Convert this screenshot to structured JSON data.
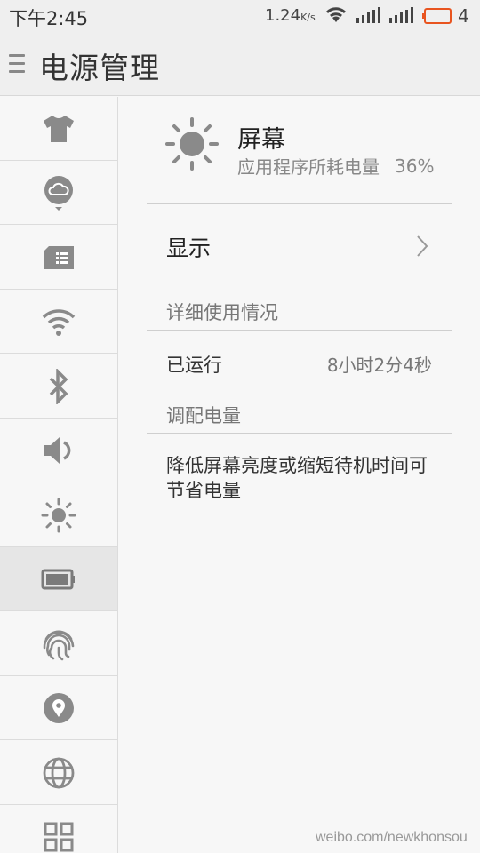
{
  "status_bar": {
    "time": "下午2:45",
    "net_speed": "1.24",
    "net_speed_unit": "K/s",
    "battery_level": "4"
  },
  "header": {
    "title": "电源管理"
  },
  "sidebar": {
    "items": [
      {
        "icon": "theme-shirt-icon"
      },
      {
        "icon": "cloud-icon"
      },
      {
        "icon": "sim-card-icon"
      },
      {
        "icon": "wifi-icon"
      },
      {
        "icon": "bluetooth-icon"
      },
      {
        "icon": "volume-icon"
      },
      {
        "icon": "brightness-icon"
      },
      {
        "icon": "battery-icon",
        "active": true
      },
      {
        "icon": "fingerprint-icon"
      },
      {
        "icon": "location-icon"
      },
      {
        "icon": "globe-icon"
      },
      {
        "icon": "apps-grid-icon"
      }
    ]
  },
  "detail": {
    "title": "屏幕",
    "subtitle": "应用程序所耗电量",
    "percentage": "36%",
    "display_label": "显示",
    "usage_section": "详细使用情况",
    "running_label": "已运行",
    "running_value": "8小时2分4秒",
    "adjust_section": "调配电量",
    "tip": "降低屏幕亮度或缩短待机时间可节省电量"
  },
  "watermark": "weibo.com/newkhonsou",
  "colors": {
    "icon_gray": "#8a8a8a",
    "battery_low": "#e8541f",
    "active_bg": "#e6e6e6"
  }
}
